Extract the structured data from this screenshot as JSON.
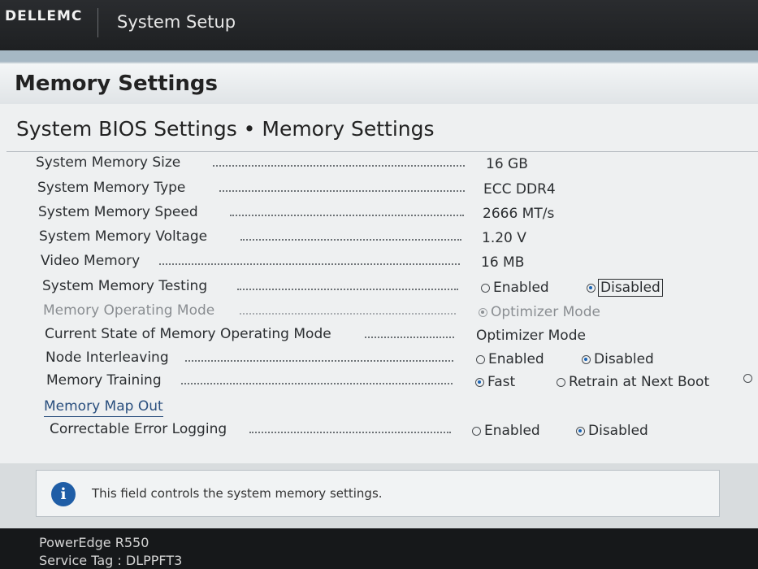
{
  "header": {
    "brand": "DELLEMC",
    "app_title": "System Setup"
  },
  "page": {
    "title": "Memory Settings",
    "section_title": "System BIOS Settings • Memory Settings"
  },
  "settings": {
    "memory_size": {
      "label": "System Memory Size",
      "value": "16 GB"
    },
    "memory_type": {
      "label": "System Memory Type",
      "value": "ECC DDR4"
    },
    "memory_speed": {
      "label": "System Memory Speed",
      "value": "2666 MT/s"
    },
    "memory_voltage": {
      "label": "System Memory Voltage",
      "value": "1.20 V"
    },
    "video_memory": {
      "label": "Video Memory",
      "value": "16 MB"
    },
    "memory_testing": {
      "label": "System Memory Testing",
      "options": [
        "Enabled",
        "Disabled"
      ],
      "selected": "Disabled"
    },
    "operating_mode": {
      "label": "Memory Operating Mode",
      "options": [
        "Optimizer Mode"
      ],
      "selected": "Optimizer Mode"
    },
    "current_mode": {
      "label": "Current State of Memory Operating Mode",
      "value": "Optimizer Mode"
    },
    "node_interleaving": {
      "label": "Node Interleaving",
      "options": [
        "Enabled",
        "Disabled"
      ],
      "selected": "Disabled"
    },
    "memory_training": {
      "label": "Memory Training",
      "options": [
        "Fast",
        "Retrain at Next Boot"
      ],
      "selected": "Fast"
    },
    "memory_map_out": {
      "label": "Memory Map Out"
    },
    "error_logging": {
      "label": "Correctable Error Logging",
      "options": [
        "Enabled",
        "Disabled"
      ],
      "selected": "Disabled"
    }
  },
  "help": {
    "text": "This field controls the system memory settings."
  },
  "footer": {
    "model": "PowerEdge R550",
    "service_tag": "Service Tag : DLPPFT3"
  },
  "icons": {
    "info": "info-icon"
  }
}
